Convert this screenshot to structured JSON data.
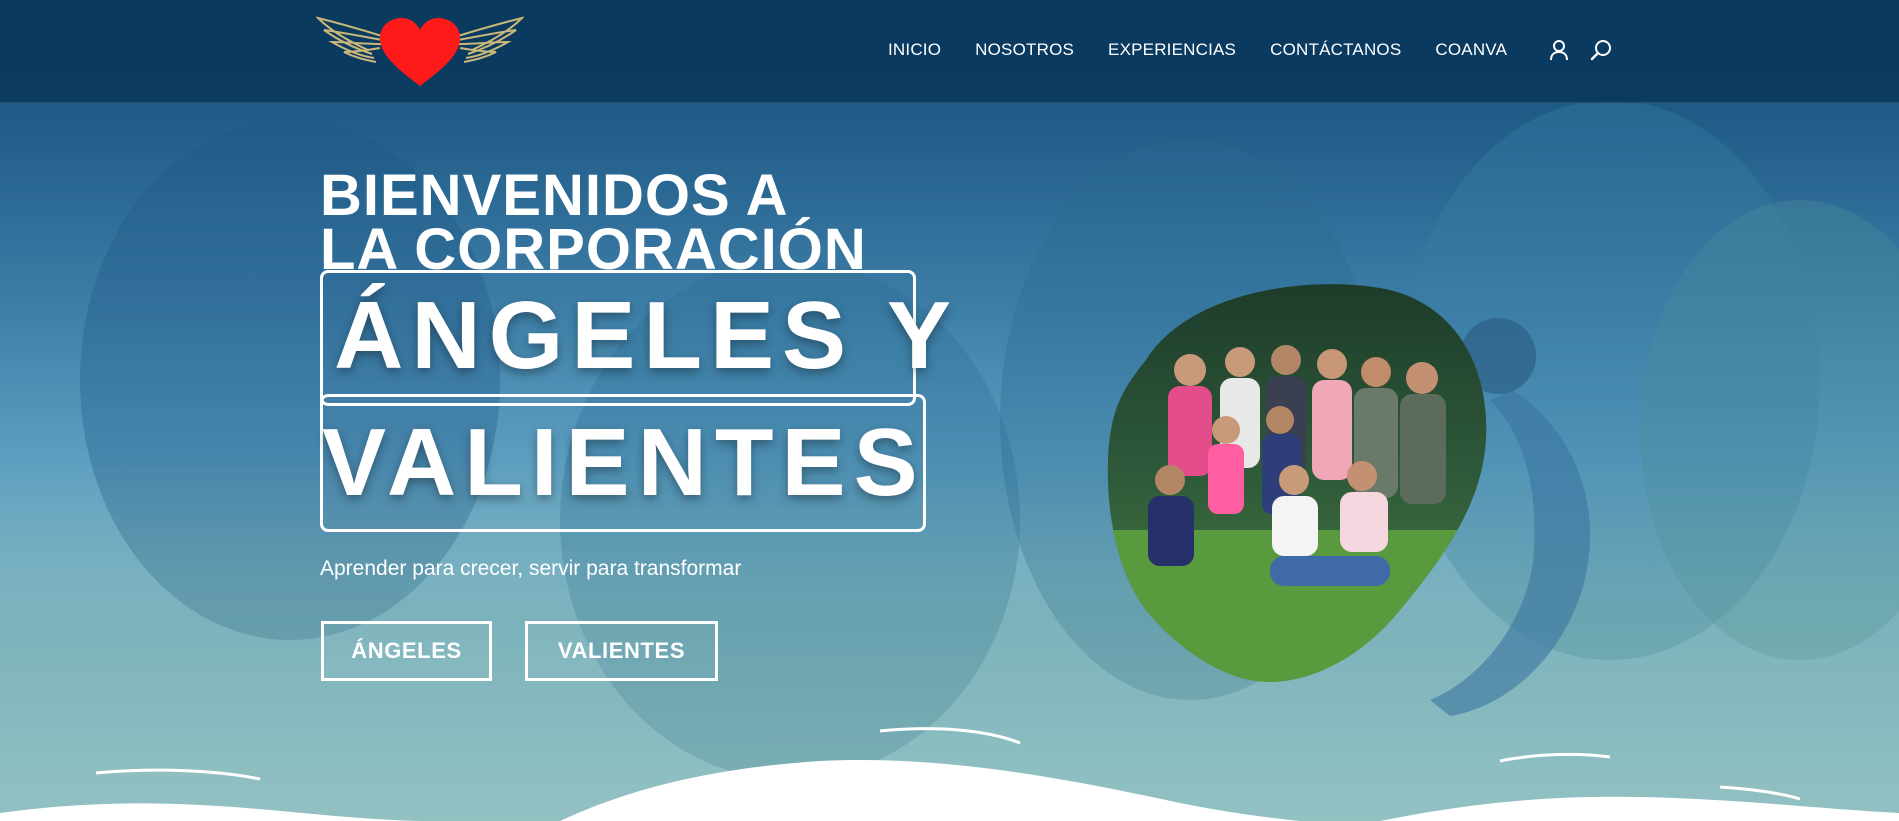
{
  "header": {
    "nav": [
      {
        "label": "INICIO"
      },
      {
        "label": "NOSOTROS"
      },
      {
        "label": "EXPERIENCIAS"
      },
      {
        "label": "CONTÁCTANOS"
      },
      {
        "label": "COANVA"
      }
    ],
    "icons": {
      "account": "user-icon",
      "search": "search-icon"
    }
  },
  "hero": {
    "line1": "BIENVENIDOS A",
    "line2": "LA CORPORACIÓN",
    "word1": "ÁNGELES Y",
    "word2": "VALIENTES",
    "tagline": "Aprender para crecer, servir para transformar",
    "buttons": [
      {
        "label": "ÁNGELES"
      },
      {
        "label": "VALIENTES"
      }
    ]
  },
  "colors": {
    "header_bg": "#0a385c",
    "heart": "#ff1a1a",
    "wings": "#c9b77a",
    "text": "#ffffff"
  }
}
